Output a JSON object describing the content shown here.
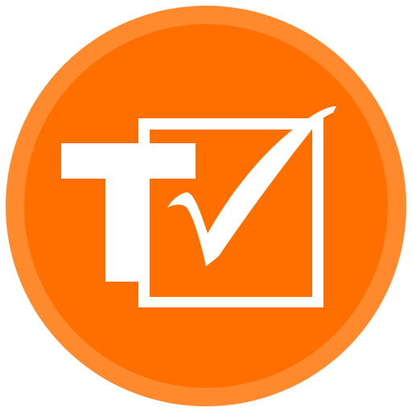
{
  "app_icon": {
    "icon_name": "tv-checkmark-logo-icon",
    "colors": {
      "outer_ring": "#ff8a2e",
      "inner_disc": "#ff6f00",
      "glyph": "#ffffff"
    }
  }
}
